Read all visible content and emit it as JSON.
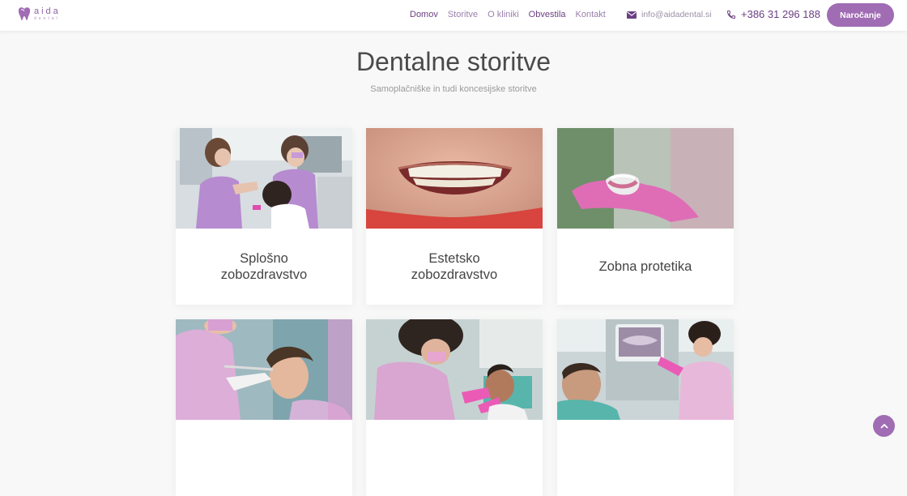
{
  "brand": {
    "name": "aida",
    "tagline": "dental"
  },
  "nav": {
    "items": [
      {
        "label": "Domov",
        "active": true
      },
      {
        "label": "Storitve",
        "active": false
      },
      {
        "label": "O kliniki",
        "active": false
      },
      {
        "label": "Obvestila",
        "active": true
      },
      {
        "label": "Kontakt",
        "active": false
      }
    ]
  },
  "contact": {
    "email": "info@aidadental.si",
    "phone": "+386 31 296 188"
  },
  "header": {
    "book_label": "Naročanje"
  },
  "main": {
    "title": "Dentalne storitve",
    "subtitle": "Samoplačniške in tudi koncesijske storitve",
    "cards": [
      {
        "title_line1": "Splošno",
        "title_line2": "zobozdravstvo",
        "image": "dentists-treating-patient-photo"
      },
      {
        "title_line1": "Estetsko",
        "title_line2": "zobozdravstvo",
        "image": "smile-closeup-photo"
      },
      {
        "title_line1": "Zobna protetika",
        "title_line2": "",
        "image": "denture-in-hand-photo"
      },
      {
        "title_line1": "",
        "title_line2": "",
        "image": "dental-cleaning-photo"
      },
      {
        "title_line1": "",
        "title_line2": "",
        "image": "dentist-examining-patient-photo"
      },
      {
        "title_line1": "",
        "title_line2": "",
        "image": "dental-xray-screen-photo"
      }
    ]
  },
  "colors": {
    "accent": "#a06cb4",
    "nav_active": "#6b3f84",
    "nav": "#9a7fab",
    "background": "#f7f8f7"
  },
  "icons": {
    "email": "envelope-icon",
    "phone": "phone-icon",
    "scroll_top": "chevron-up-icon"
  }
}
